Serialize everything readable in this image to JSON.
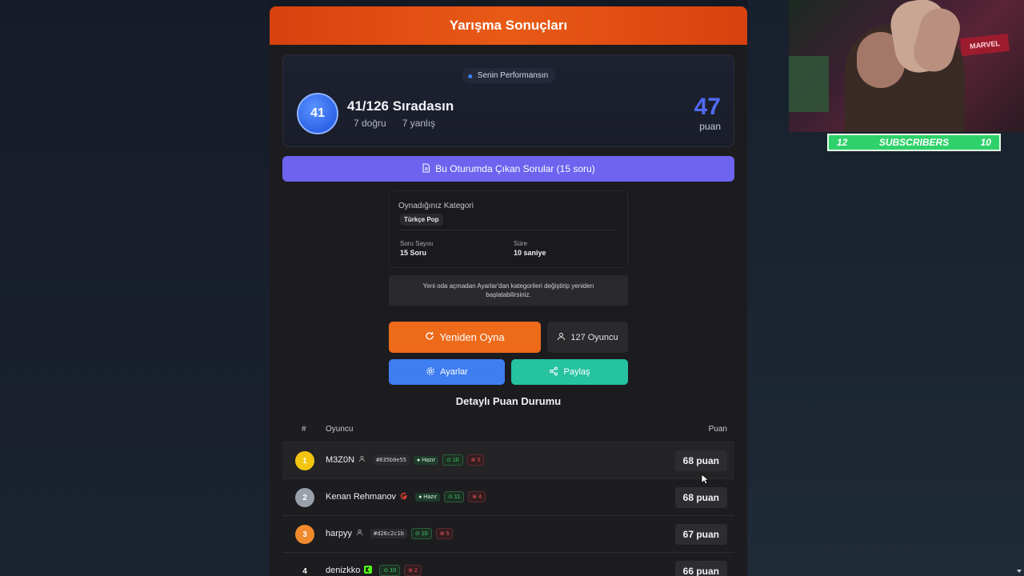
{
  "header": {
    "title": "Yarışma Sonuçları"
  },
  "performance": {
    "badge": "Senin Performansın",
    "rank": "41",
    "title": "41/126 Sıradasın",
    "correct": "7 doğru",
    "wrong": "7 yanlış",
    "score": "47",
    "score_unit": "puan"
  },
  "questions_button": {
    "label": "Bu Oturumda Çıkan Sorular (15 soru)"
  },
  "category": {
    "label": "Oynadığınız Kategori",
    "tag": "Türkçe Pop",
    "question_count_label": "Soru Sayısı",
    "question_count_value": "15 Soru",
    "time_label": "Süre",
    "time_value": "10 saniye"
  },
  "note": "Yeni oda açmadan Ayarlar'dan kategorileri değiştirip yeniden başlatabilirsiniz.",
  "actions": {
    "replay": "Yeniden Oyna",
    "players": "127 Oyuncu",
    "settings": "Ayarlar",
    "share": "Paylaş"
  },
  "leaderboard": {
    "title": "Detaylı Puan Durumu",
    "col_num": "#",
    "col_player": "Oyuncu",
    "col_score": "Puan",
    "rows": [
      {
        "pos": "1",
        "name": "M3Z0N",
        "id": "#835b0e55",
        "ready": "Hazır",
        "correct": "10",
        "wrong": "5",
        "score": "68 puan"
      },
      {
        "pos": "2",
        "name": "Kenan Rehmanov",
        "ready": "Hazır",
        "correct": "11",
        "wrong": "4",
        "score": "68 puan"
      },
      {
        "pos": "3",
        "name": "harpyy",
        "id": "#d26c2c1b",
        "correct": "10",
        "wrong": "5",
        "score": "67 puan"
      },
      {
        "pos": "4",
        "name": "denizkko",
        "correct": "10",
        "wrong": "2",
        "score": "66 puan"
      }
    ]
  },
  "stream": {
    "sub_left": "12",
    "sub_label": "SUBSCRIBERS",
    "sub_right": "10",
    "webcam_sign": "MARVEL"
  },
  "colors": {
    "header": "#e0500f",
    "accent_blue": "#4f6bf2",
    "replay": "#ed6a1b",
    "settings": "#3f7ef0",
    "share": "#26c3a0",
    "questions": "#6c62ee",
    "gold": "#f2c511",
    "silver": "#9aa0aa",
    "bronze": "#f08a2c"
  }
}
